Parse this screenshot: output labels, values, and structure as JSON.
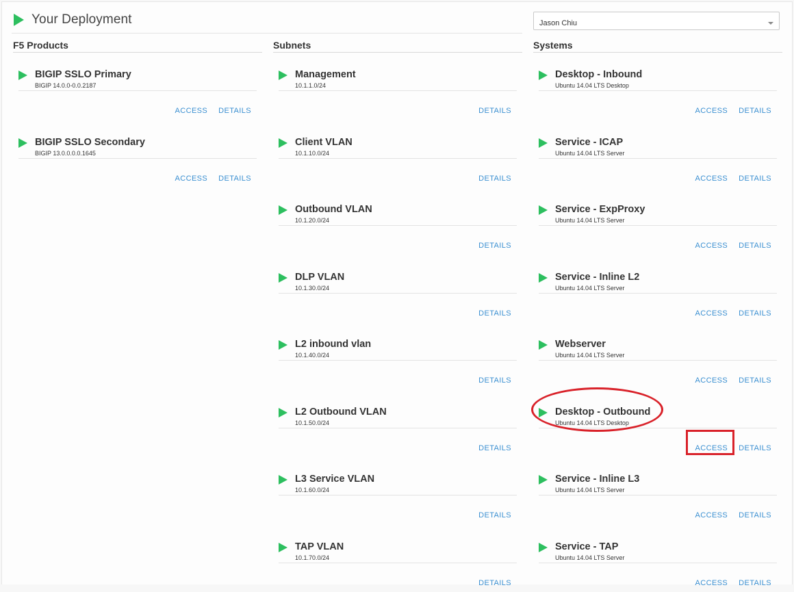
{
  "header": {
    "title": "Your Deployment"
  },
  "user_select": {
    "value": "Jason Chiu"
  },
  "columns": {
    "products": {
      "title": "F5 Products",
      "items": [
        {
          "name": "BIGIP SSLO Primary",
          "sub": "BIGIP 14.0.0-0.0.2187",
          "access": "ACCESS",
          "details": "DETAILS"
        },
        {
          "name": "BIGIP SSLO Secondary",
          "sub": "BIGIP 13.0.0.0.0.1645",
          "access": "ACCESS",
          "details": "DETAILS"
        }
      ]
    },
    "subnets": {
      "title": "Subnets",
      "items": [
        {
          "name": "Management",
          "sub": "10.1.1.0/24",
          "details": "DETAILS"
        },
        {
          "name": "Client VLAN",
          "sub": "10.1.10.0/24",
          "details": "DETAILS"
        },
        {
          "name": "Outbound VLAN",
          "sub": "10.1.20.0/24",
          "details": "DETAILS"
        },
        {
          "name": "DLP VLAN",
          "sub": "10.1.30.0/24",
          "details": "DETAILS"
        },
        {
          "name": "L2 inbound vlan",
          "sub": "10.1.40.0/24",
          "details": "DETAILS"
        },
        {
          "name": "L2 Outbound VLAN",
          "sub": "10.1.50.0/24",
          "details": "DETAILS"
        },
        {
          "name": "L3 Service VLAN",
          "sub": "10.1.60.0/24",
          "details": "DETAILS"
        },
        {
          "name": "TAP VLAN",
          "sub": "10.1.70.0/24",
          "details": "DETAILS"
        }
      ]
    },
    "systems": {
      "title": "Systems",
      "items": [
        {
          "name": "Desktop - Inbound",
          "sub": "Ubuntu 14.04 LTS Desktop",
          "access": "ACCESS",
          "details": "DETAILS"
        },
        {
          "name": "Service - ICAP",
          "sub": "Ubuntu 14.04 LTS Server",
          "access": "ACCESS",
          "details": "DETAILS"
        },
        {
          "name": "Service - ExpProxy",
          "sub": "Ubuntu 14.04 LTS Server",
          "access": "ACCESS",
          "details": "DETAILS"
        },
        {
          "name": "Service - Inline L2",
          "sub": "Ubuntu 14.04 LTS Server",
          "access": "ACCESS",
          "details": "DETAILS"
        },
        {
          "name": "Webserver",
          "sub": "Ubuntu 14.04 LTS Server",
          "access": "ACCESS",
          "details": "DETAILS"
        },
        {
          "name": "Desktop - Outbound",
          "sub": "Ubuntu 14.04 LTS Desktop",
          "access": "ACCESS",
          "details": "DETAILS"
        },
        {
          "name": "Service - Inline L3",
          "sub": "Ubuntu 14.04 LTS Server",
          "access": "ACCESS",
          "details": "DETAILS"
        },
        {
          "name": "Service - TAP",
          "sub": "Ubuntu 14.04 LTS Server",
          "access": "ACCESS",
          "details": "DETAILS"
        }
      ]
    }
  },
  "annotations": {
    "color": "#d9222a",
    "ellipse_target": "Desktop - Outbound",
    "rect_target": "Desktop - Outbound ACCESS"
  },
  "colors": {
    "accent_green": "#2dbf5f",
    "link_blue": "#3a8fd1"
  }
}
